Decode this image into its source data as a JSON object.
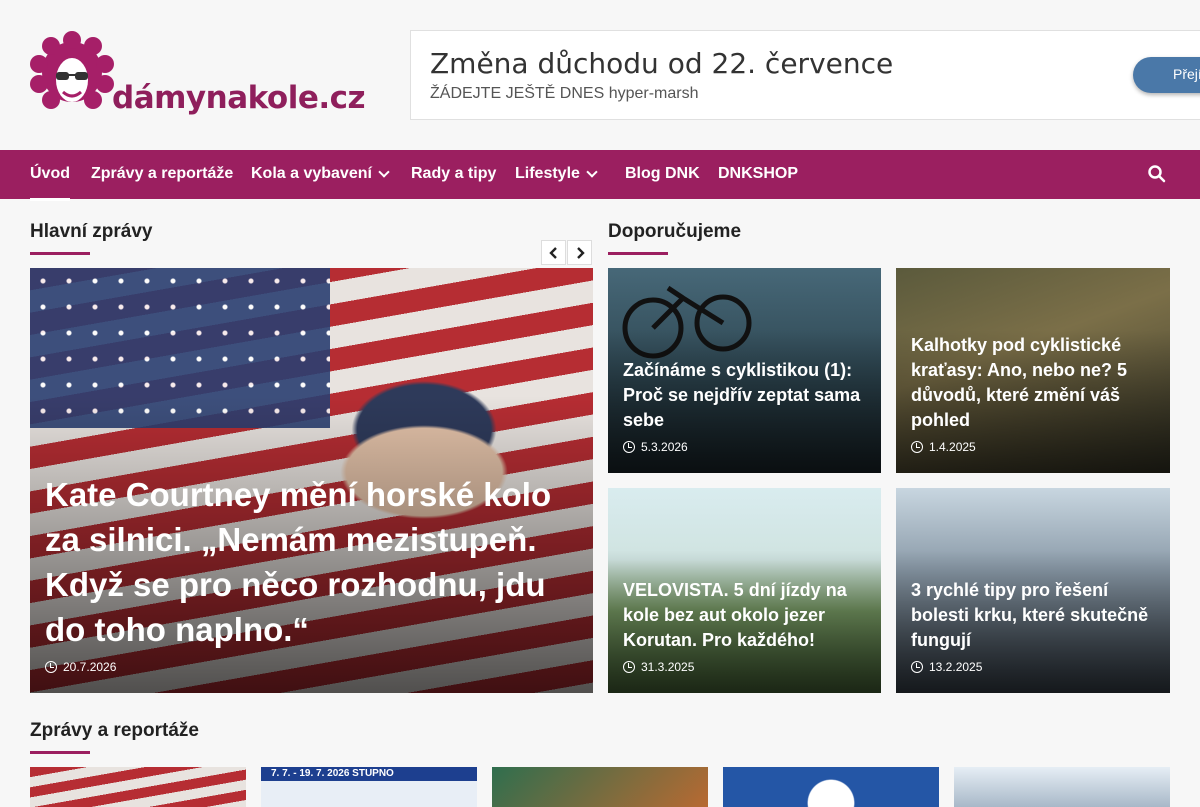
{
  "site": {
    "logo_text": "dámynakole.cz"
  },
  "ad": {
    "title": "Změna důchodu od 22. července",
    "subtitle": "ŽÁDEJTE JEŠTĚ DNES hyper-marsh",
    "button": "Přejít"
  },
  "nav": {
    "items": [
      {
        "label": "Úvod",
        "dropdown": false
      },
      {
        "label": "Zprávy a reportáže",
        "dropdown": false
      },
      {
        "label": "Kola a vybavení",
        "dropdown": true
      },
      {
        "label": "Rady a tipy",
        "dropdown": false
      },
      {
        "label": "Lifestyle",
        "dropdown": true
      },
      {
        "label": "Blog DNK",
        "dropdown": false
      },
      {
        "label": "DNKSHOP",
        "dropdown": false
      }
    ],
    "search_icon": "search-icon"
  },
  "main_news": {
    "heading": "Hlavní zprávy",
    "article": {
      "title": "Kate Courtney mění horské kolo za silnici. „Nemám mezistupeň. Když se pro něco rozhodnu, jdu do toho naplno.“",
      "date": "20.7.2026"
    }
  },
  "recommended": {
    "heading": "Doporučujeme",
    "articles": [
      {
        "title": "Začínáme s cyklistikou (1): Proč se nejdřív zeptat sama sebe",
        "date": "5.3.2026"
      },
      {
        "title": "Kalhotky pod cyklistické kraťasy: Ano, nebo ne? 5 důvodů, které změní váš pohled",
        "date": "1.4.2025"
      },
      {
        "title": "VELOVISTA. 5 dní jízdy na kole bez aut okolo jezer Korutan. Pro každého!",
        "date": "31.3.2025"
      },
      {
        "title": "3 rychlé tipy pro řešení bolesti krku, které skutečně fungují",
        "date": "13.2.2025"
      }
    ]
  },
  "news_section": {
    "heading": "Zprávy a reportáže",
    "banner_text": "7. 7. - 19. 7. 2026 STUPNO"
  },
  "colors": {
    "brand": "#9b1f60",
    "nav_bg": "#9b1f60",
    "ad_button": "#4a78a8"
  }
}
